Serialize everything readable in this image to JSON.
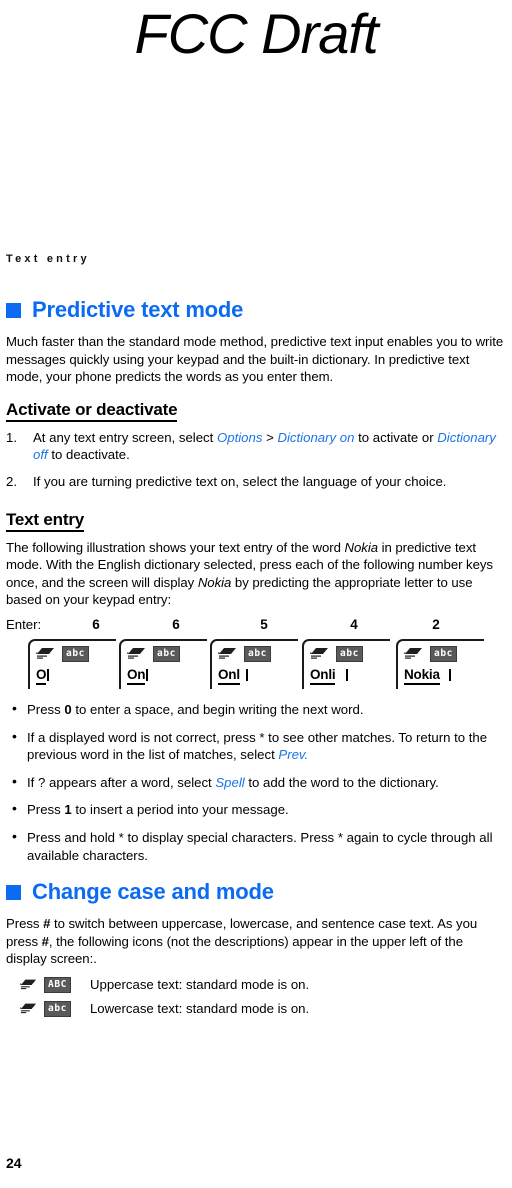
{
  "watermark": {
    "text": "FCC Draft"
  },
  "running_header": {
    "text": "Text entry"
  },
  "colors": {
    "heading_blue": "#0b6bf2",
    "ui_label_blue": "#1a74e8",
    "badge_gray": "#5a5a5a",
    "text_black": "#000000"
  },
  "sections": {
    "predictive": {
      "heading": "Predictive text mode",
      "intro": "Much faster than the standard mode method, predictive text input enables you to write messages quickly using your keypad and the built-in dictionary. In predictive text mode, your phone predicts the words as you enter them.",
      "activate": {
        "subheading": "Activate or deactivate",
        "steps": [
          {
            "number": "1.",
            "parts": [
              {
                "t": "At any text entry screen, select ",
                "s": "plain"
              },
              {
                "t": "Options",
                "s": "ui"
              },
              {
                "t": " > ",
                "s": "plain"
              },
              {
                "t": "Dictionary on",
                "s": "ui"
              },
              {
                "t": " to activate or ",
                "s": "plain"
              },
              {
                "t": "Dictionary off",
                "s": "ui"
              },
              {
                "t": " to deactivate.",
                "s": "plain"
              }
            ]
          },
          {
            "number": "2.",
            "parts": [
              {
                "t": "If you are turning predictive text on, select the language of your choice.",
                "s": "plain"
              }
            ]
          }
        ]
      },
      "text_entry": {
        "subheading": "Text entry",
        "intro_parts": [
          {
            "t": "The following illustration shows your text entry of the word ",
            "s": "plain"
          },
          {
            "t": "Nokia",
            "s": "it"
          },
          {
            "t": " in predictive text mode. With the English dictionary selected, press each of the following number keys once, and the screen will display ",
            "s": "plain"
          },
          {
            "t": "Nokia",
            "s": "it"
          },
          {
            "t": " by predicting the appropriate letter to use based on your keypad entry:",
            "s": "plain"
          }
        ],
        "enter_label": "Enter:",
        "keys": [
          "6",
          "6",
          "5",
          "4",
          "2"
        ],
        "screens": [
          {
            "icon": "predictive-pencil-icon",
            "badge": "abc",
            "word": "O"
          },
          {
            "icon": "predictive-pencil-icon",
            "badge": "abc",
            "word": "On"
          },
          {
            "icon": "predictive-pencil-icon",
            "badge": "abc",
            "word": "Onl"
          },
          {
            "icon": "predictive-pencil-icon",
            "badge": "abc",
            "word": "Onli"
          },
          {
            "icon": "predictive-pencil-icon",
            "badge": "abc",
            "word": "Nokia"
          }
        ],
        "bullets": [
          {
            "parts": [
              {
                "t": "Press ",
                "s": "plain"
              },
              {
                "t": "0",
                "s": "b"
              },
              {
                "t": " to enter a space, and begin writing the next word.",
                "s": "plain"
              }
            ]
          },
          {
            "parts": [
              {
                "t": "If a displayed word is not correct, press ",
                "s": "plain"
              },
              {
                "t": "*",
                "s": "plain"
              },
              {
                "t": " to see other matches. To return to the previous word in the list of matches, select ",
                "s": "plain"
              },
              {
                "t": "Prev.",
                "s": "ui"
              }
            ]
          },
          {
            "parts": [
              {
                "t": "If ? appears after a word, select ",
                "s": "plain"
              },
              {
                "t": "Spell",
                "s": "ui"
              },
              {
                "t": " to add the word to the dictionary.",
                "s": "plain"
              }
            ]
          },
          {
            "parts": [
              {
                "t": "Press ",
                "s": "plain"
              },
              {
                "t": "1",
                "s": "b"
              },
              {
                "t": " to insert a period into your message.",
                "s": "plain"
              }
            ]
          },
          {
            "parts": [
              {
                "t": "Press and hold ",
                "s": "plain"
              },
              {
                "t": "*",
                "s": "plain"
              },
              {
                "t": " to display special characters. Press ",
                "s": "plain"
              },
              {
                "t": "*",
                "s": "plain"
              },
              {
                "t": " again to cycle through all available characters.",
                "s": "plain"
              }
            ]
          }
        ]
      }
    },
    "change_case": {
      "heading": "Change case and mode",
      "intro_parts": [
        {
          "t": "Press ",
          "s": "plain"
        },
        {
          "t": "#",
          "s": "b"
        },
        {
          "t": " to switch between uppercase, lowercase, and sentence case text. As you press ",
          "s": "plain"
        },
        {
          "t": "#",
          "s": "b"
        },
        {
          "t": ", the following icons (not the descriptions) appear in the upper left of the display screen:.",
          "s": "plain"
        }
      ],
      "legend": [
        {
          "icon": "standard-mode-pencil-icon",
          "badge": "ABC",
          "description": "Uppercase text: standard mode is on."
        },
        {
          "icon": "standard-mode-pencil-icon",
          "badge": "abc",
          "description": "Lowercase text: standard mode is on."
        }
      ]
    }
  },
  "folio": {
    "page_number": "24"
  }
}
